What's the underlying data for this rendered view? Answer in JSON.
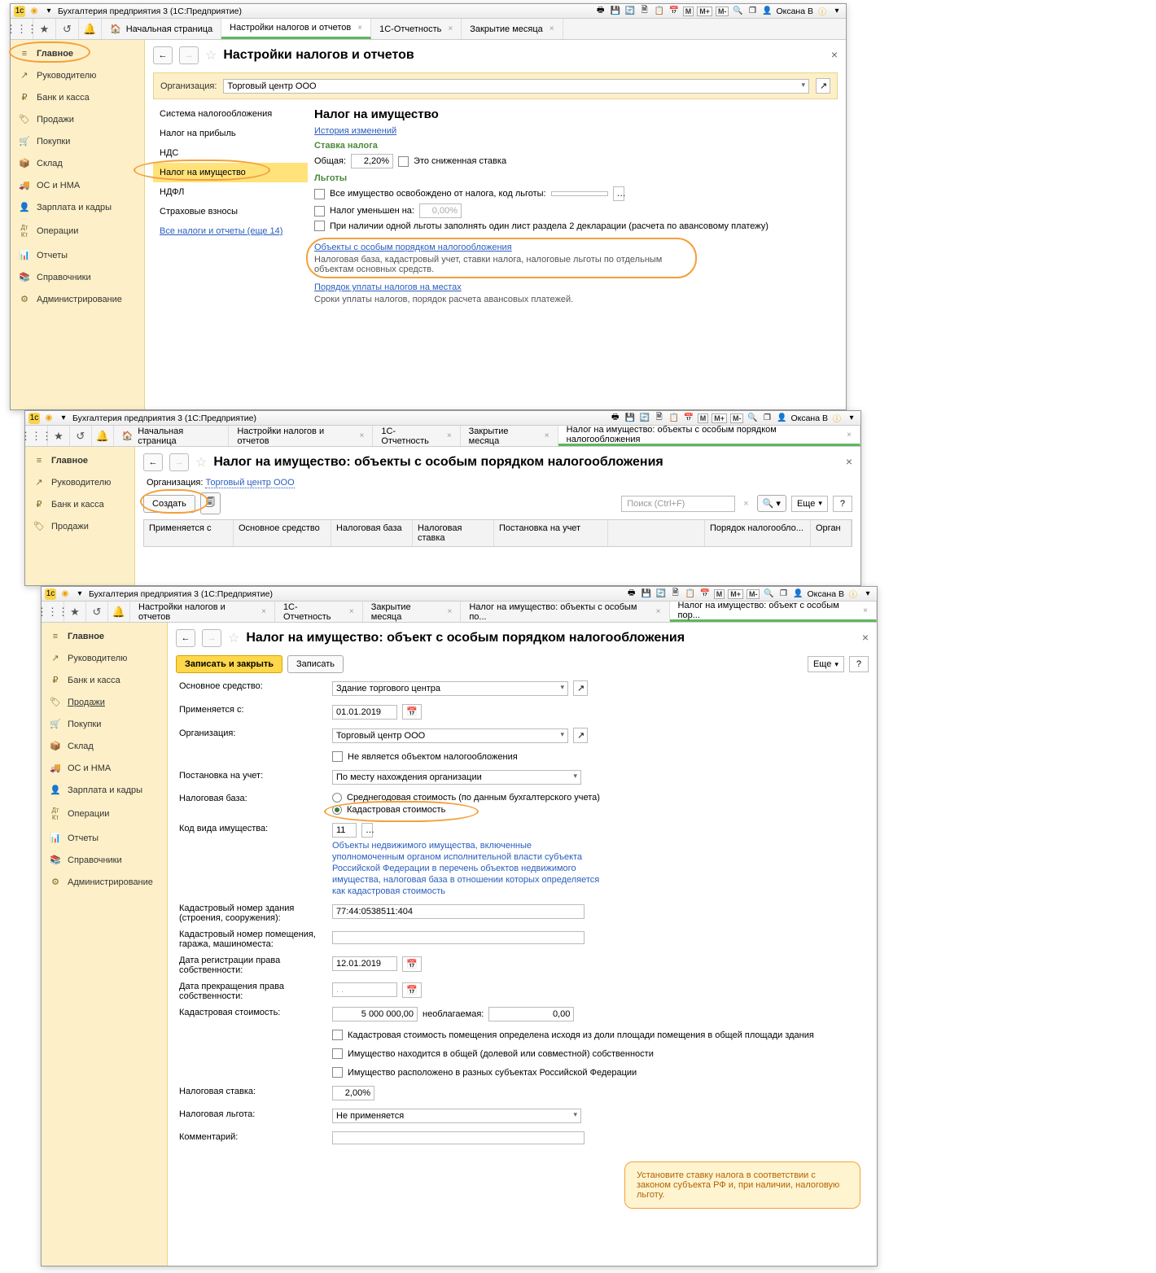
{
  "app_title": "Бухгалтерия предприятия 3   (1С:Предприятие)",
  "user": "Оксана В",
  "m_buttons": [
    "M",
    "M+",
    "M-"
  ],
  "main_tabs": {
    "home": "Начальная страница",
    "house_icon": "🏠",
    "t1": "Настройки налогов и отчетов",
    "t2": "1С-Отчетность",
    "t3": "Закрытие месяца",
    "t4": "Налог на имущество: объекты с особым порядком налогообложения",
    "t5": "Налог на имущество: объекты с особым по...",
    "t6": "Налог на имущество: объект с особым пор..."
  },
  "sidebar": [
    {
      "icon": "≡",
      "label": "Главное"
    },
    {
      "icon": "↗",
      "label": "Руководителю"
    },
    {
      "icon": "₽",
      "label": "Банк и касса"
    },
    {
      "icon": "🏷",
      "label": "Продажи"
    },
    {
      "icon": "🛒",
      "label": "Покупки"
    },
    {
      "icon": "📦",
      "label": "Склад"
    },
    {
      "icon": "🚚",
      "label": "ОС и НМА"
    },
    {
      "icon": "👤",
      "label": "Зарплата и кадры"
    },
    {
      "icon": "Дт Кт",
      "label": "Операции"
    },
    {
      "icon": "📊",
      "label": "Отчеты"
    },
    {
      "icon": "📚",
      "label": "Справочники"
    },
    {
      "icon": "⚙",
      "label": "Администрирование"
    }
  ],
  "w1": {
    "title": "Настройки налогов и отчетов",
    "org_lbl": "Организация:",
    "org_val": "Торговый центр ООО",
    "settings": [
      "Система налогообложения",
      "Налог на прибыль",
      "НДС",
      "Налог на имущество",
      "НДФЛ",
      "Страховые взносы"
    ],
    "settings_more": "Все налоги и отчеты (еще 14)",
    "h2": "Налог на имущество",
    "history": "История изменений",
    "rate_lbl": "Ставка налога",
    "rate_common": "Общая:",
    "rate_val": "2,20%",
    "rate_chk": "Это сниженная ставка",
    "benefits": "Льготы",
    "b1": "Все имущество освобождено от налога, код льготы:",
    "b2": "Налог уменьшен на:",
    "b2_val": "0,00%",
    "b3": "При наличии одной льготы заполнять один лист раздела 2 декларации (расчета по авансовому платежу)",
    "link1": "Объекты с особым порядком налогообложения",
    "desc1": "Налоговая база, кадастровый учет, ставки налога, налоговые льготы по отдельным объектам основных средств.",
    "link2": "Порядок уплаты налогов на местах",
    "desc2": "Сроки уплаты налогов, порядок расчета авансовых платежей."
  },
  "w2": {
    "title": "Налог на имущество: объекты с особым порядком налогообложения",
    "org_lbl": "Организация:",
    "org_val": "Торговый центр ООО",
    "create": "Создать",
    "search_ph": "Поиск (Ctrl+F)",
    "more": "Еще",
    "cols": [
      "Применяется с",
      "Основное средство",
      "Налоговая база",
      "Налоговая ставка",
      "Постановка на учет",
      "Порядок налогообло...",
      "Орган"
    ]
  },
  "w3": {
    "title": "Налог на имущество: объект с особым порядком налогообложения",
    "save_close": "Записать и закрыть",
    "save": "Записать",
    "more": "Еще",
    "f": {
      "os_lbl": "Основное средство:",
      "os_val": "Здание торгового центра",
      "from_lbl": "Применяется с:",
      "from_val": "01.01.2019",
      "org_lbl": "Организация:",
      "org_val": "Торговый центр ООО",
      "not_obj": "Не является объектом налогообложения",
      "reg_lbl": "Постановка на учет:",
      "reg_val": "По месту нахождения организации",
      "base_lbl": "Налоговая база:",
      "base_r1": "Среднегодовая стоимость (по данным бухгалтерского учета)",
      "base_r2": "Кадастровая стоимость",
      "kind_lbl": "Код вида имущества:",
      "kind_val": "11",
      "kind_hint": "Объекты недвижимого имущества, включенные уполномоченным органом исполнительной власти субъекта Российской Федерации в перечень объектов недвижимого имущества, налоговая база в отношении которых определяется как кадастровая стоимость",
      "knb_lbl": "Кадастровый номер здания (строения, сооружения):",
      "knb_val": "77:44:0538511:404",
      "knp_lbl": "Кадастровый номер помещения, гаража, машиноместа:",
      "knp_val": "",
      "dreg_lbl": "Дата регистрации права собственности:",
      "dreg_val": "12.01.2019",
      "dend_lbl": "Дата прекращения права собственности:",
      "dend_val": ".  .",
      "kst_lbl": "Кадастровая стоимость:",
      "kst_val": "5 000 000,00",
      "kst_nontax_lbl": "необлагаемая:",
      "kst_nontax_val": "0,00",
      "c1": "Кадастровая стоимость помещения определена исходя из доли площади помещения в общей площади здания",
      "c2": "Имущество находится в общей (долевой или совместной) собственности",
      "c3": "Имущество расположено в разных субъектах Российской Федерации",
      "rate_lbl": "Налоговая ставка:",
      "rate_val": "2,00%",
      "ben_lbl": "Налоговая льгота:",
      "ben_val": "Не применяется",
      "comm_lbl": "Комментарий:"
    },
    "callout": "Установите ставку налога в соответствии с законом субъекта РФ и, при наличии, налоговую льготу."
  }
}
